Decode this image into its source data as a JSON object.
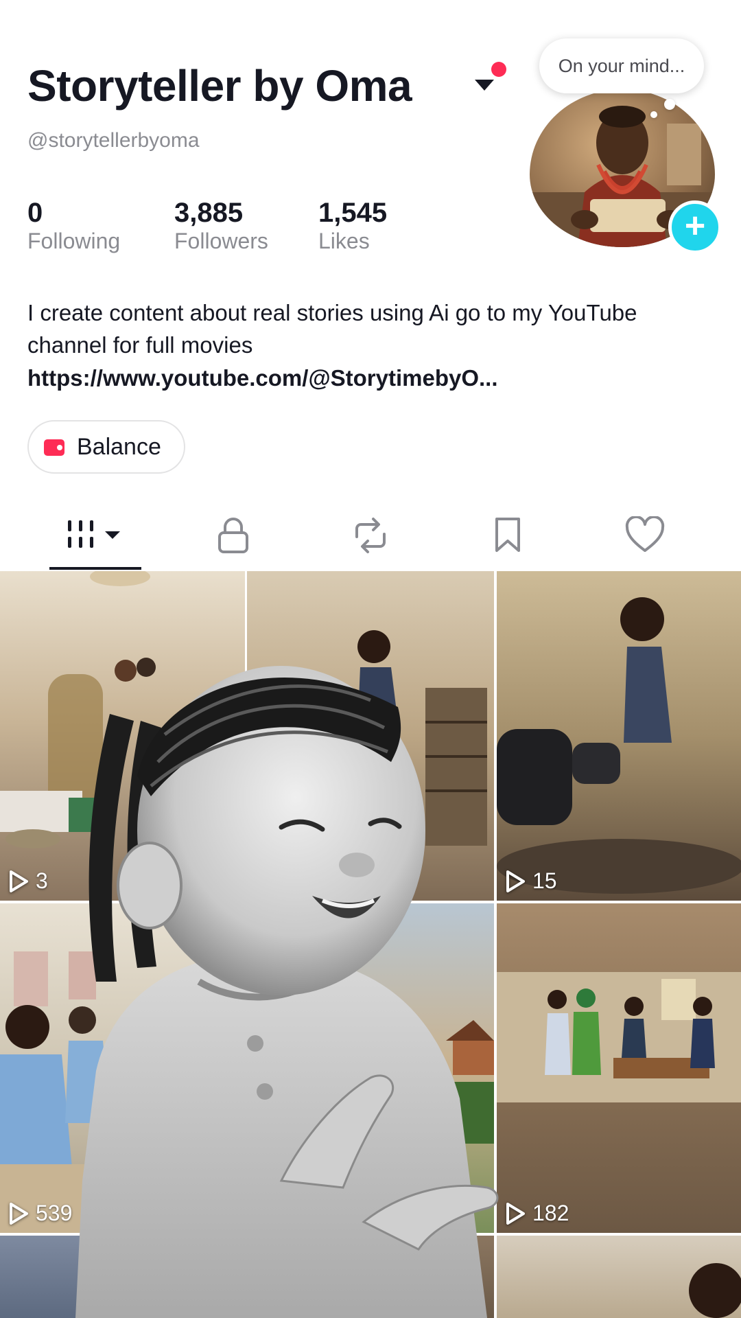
{
  "profile": {
    "display_name": "Storyteller by Oma",
    "handle": "@storytellerbyoma",
    "stats": [
      {
        "value": "0",
        "label": "Following"
      },
      {
        "value": "3,885",
        "label": "Followers"
      },
      {
        "value": "1,545",
        "label": "Likes"
      }
    ],
    "bio": "I create content about real stories using Ai go to my YouTube channel for full movies",
    "link": "https://www.youtube.com/@StorytimebyO...",
    "balance_label": "Balance",
    "bubble_text": "On your mind..."
  },
  "tabs": [
    {
      "name": "videos",
      "icon": "grid-icon"
    },
    {
      "name": "private",
      "icon": "lock-icon"
    },
    {
      "name": "reposts",
      "icon": "repost-icon"
    },
    {
      "name": "favorites",
      "icon": "bookmark-icon"
    },
    {
      "name": "liked",
      "icon": "heart-icon"
    }
  ],
  "videos": [
    {
      "views": "3"
    },
    {
      "views": ""
    },
    {
      "views": "15"
    },
    {
      "views": "539"
    },
    {
      "views": ""
    },
    {
      "views": "182"
    }
  ],
  "colors": {
    "accent": "#fe2c55",
    "add_button": "#20d5ec",
    "text": "#161823",
    "muted": "#8a8b91"
  }
}
